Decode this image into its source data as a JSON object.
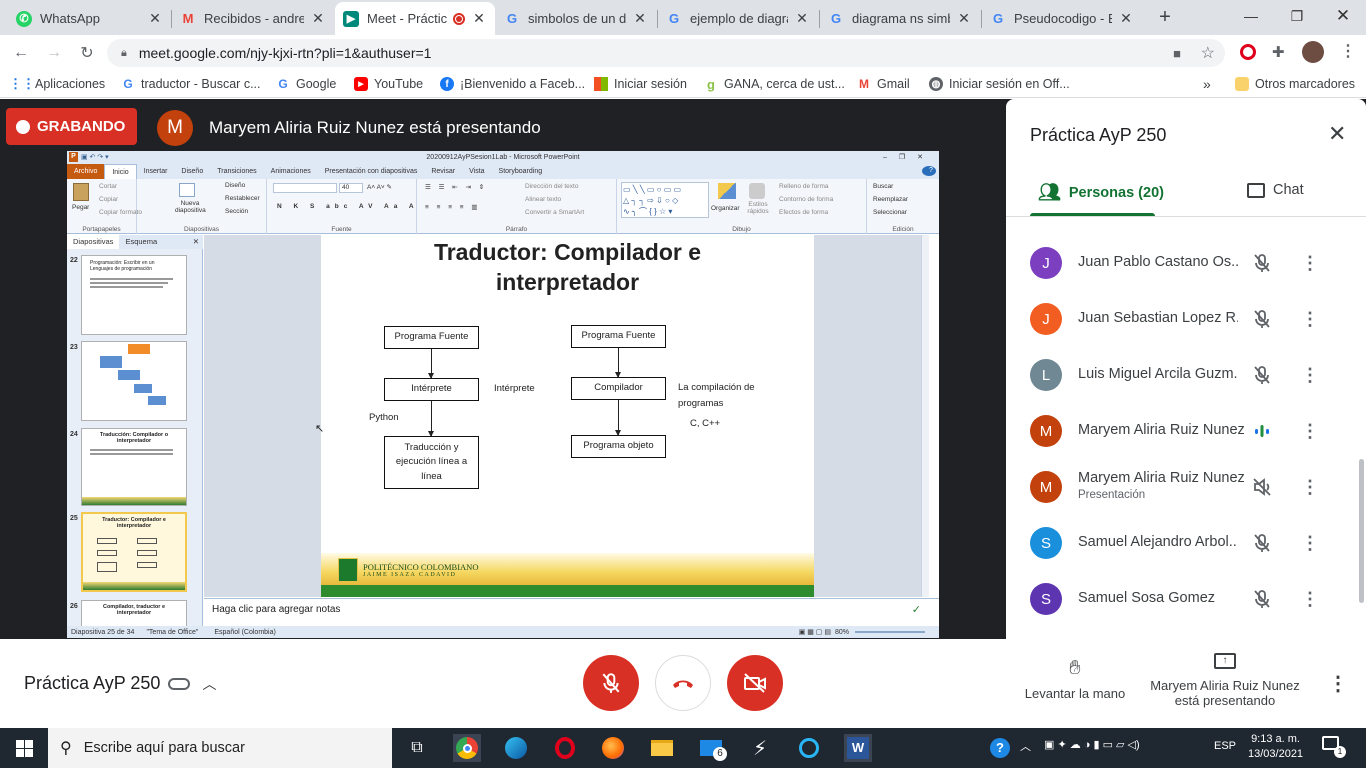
{
  "browser": {
    "tabs": [
      {
        "label": "WhatsApp",
        "icon": "whatsapp-icon"
      },
      {
        "label": "Recibidos - andres",
        "icon": "gmail-icon"
      },
      {
        "label": "Meet - Práctic",
        "icon": "meet-icon",
        "active": true
      },
      {
        "label": "simbolos de un di",
        "icon": "google-icon"
      },
      {
        "label": "ejemplo de diagra",
        "icon": "google-icon"
      },
      {
        "label": "diagrama ns simb",
        "icon": "google-icon"
      },
      {
        "label": "Pseudocodigo - Bu",
        "icon": "google-icon"
      }
    ],
    "url": "meet.google.com/njy-kjxi-rtn?pli=1&authuser=1",
    "bookmarks": [
      {
        "label": "Aplicaciones",
        "icon": "apps-icon"
      },
      {
        "label": "traductor - Buscar c...",
        "icon": "google-icon"
      },
      {
        "label": "Google",
        "icon": "google-icon"
      },
      {
        "label": "YouTube",
        "icon": "youtube-icon"
      },
      {
        "label": "¡Bienvenido a Faceb...",
        "icon": "facebook-icon"
      },
      {
        "label": "Iniciar sesión",
        "icon": "microsoft-icon"
      },
      {
        "label": "GANA, cerca de ust...",
        "icon": "gana-icon"
      },
      {
        "label": "Gmail",
        "icon": "gmail-icon"
      },
      {
        "label": "Iniciar sesión en Off...",
        "icon": "globe-icon"
      }
    ],
    "other_bookmarks": "Otros marcadores",
    "overflow": "»"
  },
  "meet": {
    "recording_label": "GRABANDO",
    "presenter_initial": "M",
    "presenter_text": "Maryem Aliria Ruiz Nunez está presentando",
    "meeting_name": "Práctica AyP 250",
    "panel": {
      "title": "Práctica AyP 250",
      "people_tab": "Personas (20)",
      "chat_tab": "Chat",
      "people": [
        {
          "initial": "J",
          "name": "Juan Pablo Castano Os...",
          "color": "#7b3fbf",
          "mic": "muted"
        },
        {
          "initial": "J",
          "name": "Juan Sebastian Lopez R...",
          "color": "#f25d22",
          "mic": "muted"
        },
        {
          "initial": "L",
          "name": "Luis Miguel Arcila Guzm...",
          "color": "#6f8894",
          "mic": "muted"
        },
        {
          "initial": "M",
          "name": "Maryem Aliria Ruiz Nunez",
          "color": "#c2410c",
          "mic": "speaking"
        },
        {
          "initial": "M",
          "name": "Maryem Aliria Ruiz Nunez",
          "sub": "Presentación",
          "color": "#c2410c",
          "mic": "volume-off"
        },
        {
          "initial": "S",
          "name": "Samuel Alejandro Arbol...",
          "color": "#1a8fdc",
          "mic": "muted"
        },
        {
          "initial": "S",
          "name": "Samuel Sosa Gomez",
          "color": "#5e35b1",
          "mic": "muted"
        }
      ]
    },
    "controls": {
      "raise_hand": "Levantar la mano",
      "presenting_line1": "Maryem Aliria Ruiz Nunez",
      "presenting_line2": "está presentando"
    }
  },
  "powerpoint": {
    "title_bar": "20200912AyPSesion1Lab - Microsoft PowerPoint",
    "tabs": [
      "Archivo",
      "Inicio",
      "Insertar",
      "Diseño",
      "Transiciones",
      "Animaciones",
      "Presentación con diapositivas",
      "Revisar",
      "Vista",
      "Storyboarding"
    ],
    "ribbon": {
      "portapapeles": {
        "label": "Portapapeles",
        "pegar": "Pegar",
        "cortar": "Cortar",
        "copiar": "Copiar",
        "copiar_formato": "Copiar formato"
      },
      "diapositivas": {
        "label": "Diapositivas",
        "nueva": "Nueva diapositiva",
        "diseno": "Diseño",
        "restablecer": "Restablecer",
        "seccion": "Sección"
      },
      "fuente": {
        "label": "Fuente",
        "size": "40"
      },
      "parrafo": {
        "label": "Párrafo",
        "direccion": "Dirección del texto",
        "alinear": "Alinear texto",
        "smartart": "Convertir a SmartArt"
      },
      "dibujo": {
        "label": "Dibujo",
        "organizar": "Organizar",
        "estilos": "Estilos rápidos",
        "relleno": "Relleno de forma",
        "contorno": "Contorno de forma",
        "efectos": "Efectos de forma"
      },
      "edicion": {
        "label": "Edición",
        "buscar": "Buscar",
        "reemplazar": "Reemplazar",
        "seleccionar": "Seleccionar"
      }
    },
    "pane_tabs": [
      "Diapositivas",
      "Esquema"
    ],
    "thumbnails": [
      {
        "num": "22",
        "title": "Programación: Escribir en un Lenguajes de programación"
      },
      {
        "num": "23",
        "title": ""
      },
      {
        "num": "24",
        "title": "Traducción: Compilador o interpretador"
      },
      {
        "num": "25",
        "title": "Traductor: Compilador e interpretador"
      },
      {
        "num": "26",
        "title": "Compilador, traductor e interpretador"
      }
    ],
    "slide": {
      "title_line1": "Traductor: Compilador e",
      "title_line2": "interpretador",
      "left_box1": "Programa Fuente",
      "left_box2": "Intérprete",
      "left_box3_l1": "Traducción y",
      "left_box3_l2": "ejecución línea a",
      "left_box3_l3": "línea",
      "python": "Python",
      "interprete_label": "Intérprete",
      "right_box1": "Programa Fuente",
      "right_box2": "Compilador",
      "right_box3": "Programa objeto",
      "compile_note_l1": "La compilación de",
      "compile_note_l2": "programas",
      "cpp": "C, C++",
      "logo_line1": "POLITÉCNICO COLOMBIANO",
      "logo_line2": "JAIME ISAZA CADAVID"
    },
    "notes_placeholder": "Haga clic para agregar notas",
    "status": {
      "slide": "Diapositiva 25 de 34",
      "theme": "\"Tema de Office\"",
      "lang": "Español (Colombia)",
      "zoom": "80%"
    }
  },
  "taskbar": {
    "search_placeholder": "Escribe aquí para buscar",
    "mail_badge": "6",
    "language": "ESP",
    "time": "9:13 a. m.",
    "date": "13/03/2021",
    "notif_count": "1"
  }
}
